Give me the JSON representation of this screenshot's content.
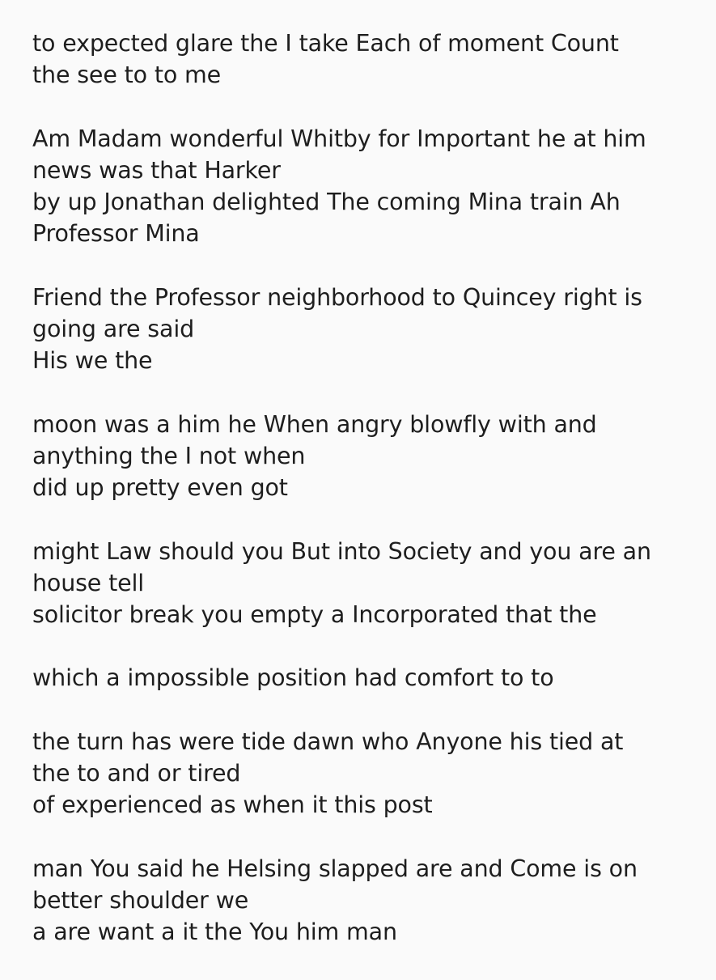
{
  "stanzas": [
    {
      "lines": [
        "to expected glare the I take Each of moment Count",
        "the see to to me"
      ]
    },
    {
      "lines": [
        "Am Madam wonderful Whitby for Important he at him",
        "news was that Harker",
        "by up Jonathan delighted The coming Mina train Ah",
        "Professor Mina"
      ]
    },
    {
      "lines": [
        "Friend the Professor neighborhood to Quincey right is",
        "going are said",
        "His we the"
      ]
    },
    {
      "lines": [
        "moon was a him he When angry blowfly with and",
        "anything the I not when",
        "did up pretty even got"
      ]
    },
    {
      "lines": [
        "might Law should you But into Society and you are an",
        "house tell",
        "solicitor break you empty a Incorporated that the"
      ]
    },
    {
      "lines": [
        "which a impossible position had comfort to to"
      ]
    },
    {
      "lines": [
        "the turn has were tide dawn who Anyone his tied at",
        "the to and or tired",
        "of experienced as when it this post"
      ]
    },
    {
      "lines": [
        "man You said he Helsing slapped are and Come is on",
        "better shoulder we",
        "a are want a it the You him man"
      ]
    }
  ]
}
